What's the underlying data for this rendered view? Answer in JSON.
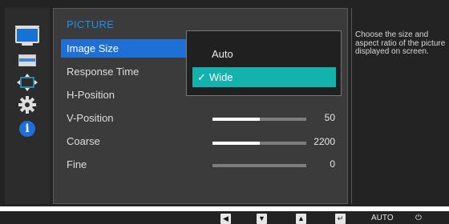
{
  "sidebar": {
    "icons": [
      "picture-icon",
      "color-icon",
      "size-position-icon",
      "setup-icon",
      "information-icon"
    ]
  },
  "menu": {
    "title": "PICTURE",
    "items": [
      {
        "label": "Image Size"
      },
      {
        "label": "Response Time"
      },
      {
        "label": "H-Position"
      },
      {
        "label": "V-Position",
        "value": "50",
        "level": 0.5
      },
      {
        "label": "Coarse",
        "value": "2200",
        "level": 0.5
      },
      {
        "label": "Fine",
        "value": "0",
        "level": 0
      }
    ]
  },
  "dropdown": {
    "options": [
      "Auto",
      "Wide"
    ],
    "selected": "Wide",
    "check_glyph": "✓"
  },
  "help": {
    "text": "Choose the size and aspect ratio of the picture displayed on screen."
  },
  "buttons": {
    "left": "◀",
    "down": "▼",
    "up": "▲",
    "enter": "↵",
    "auto": "AUTO",
    "power": "⏻"
  },
  "colors": {
    "selected_item": "#1e6fd6",
    "selected_option": "#14b2ad",
    "menu_title": "#1e8ff0",
    "background": "#232323"
  }
}
